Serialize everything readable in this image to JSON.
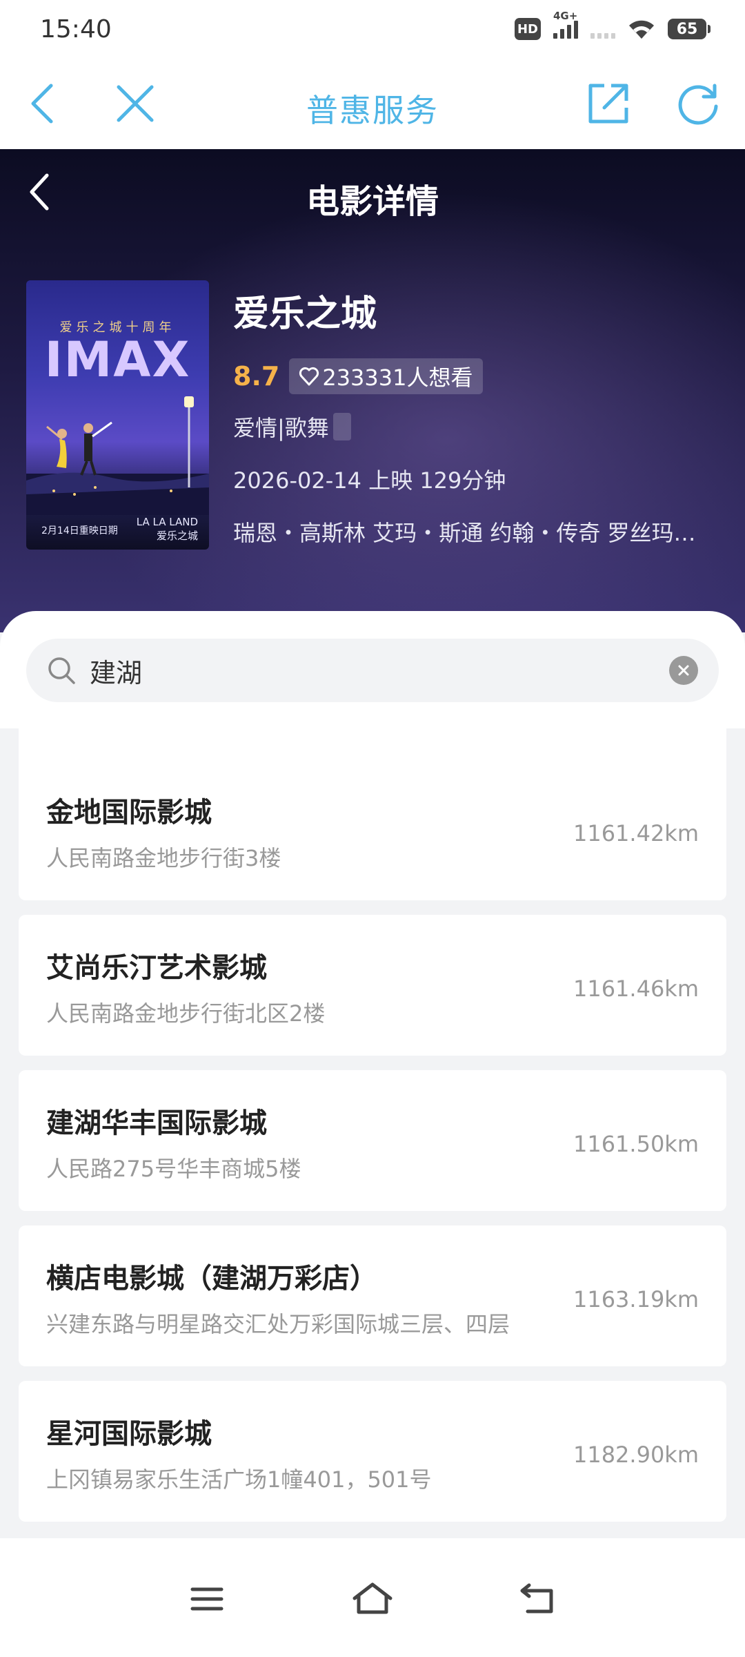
{
  "status_bar": {
    "time": "15:40",
    "hd_label": "HD",
    "network_label": "4G+",
    "battery": "65"
  },
  "nav": {
    "title": "普惠服务",
    "icons": [
      "back-icon",
      "close-icon",
      "share-icon",
      "refresh-icon"
    ]
  },
  "hero": {
    "title": "电影详情",
    "poster": {
      "top_text": "爱乐之城十周年",
      "imax_text": "IMAX",
      "bottom_left": "2月14日重映日期",
      "bottom_right_line1": "LA LA LAND",
      "bottom_right_line2": "爱乐之城"
    },
    "movie": {
      "name": "爱乐之城",
      "score": "8.7",
      "want": "233331人想看",
      "genres": "爱情|歌舞",
      "release": "2026-02-14 上映 129分钟",
      "cast": "瑞恩・高斯林 艾玛・斯通 约翰・传奇 罗丝玛…"
    }
  },
  "search": {
    "value": "建湖"
  },
  "cinemas": [
    {
      "name": "金地国际影城",
      "address": "人民南路金地步行街3楼",
      "distance": "1161.42km"
    },
    {
      "name": "艾尚乐汀艺术影城",
      "address": "人民南路金地步行街北区2楼",
      "distance": "1161.46km"
    },
    {
      "name": "建湖华丰国际影城",
      "address": "人民路275号华丰商城5楼",
      "distance": "1161.50km"
    },
    {
      "name": "横店电影城（建湖万彩店）",
      "address": "兴建东路与明星路交汇处万彩国际城三层、四层",
      "distance": "1163.19km"
    },
    {
      "name": "星河国际影城",
      "address": "上冈镇易家乐生活广场1幢401，501号",
      "distance": "1182.90km"
    }
  ],
  "colors": {
    "accent": "#4fb5e6",
    "score": "#f5b24a",
    "hero_dark": "#0c0c22"
  }
}
